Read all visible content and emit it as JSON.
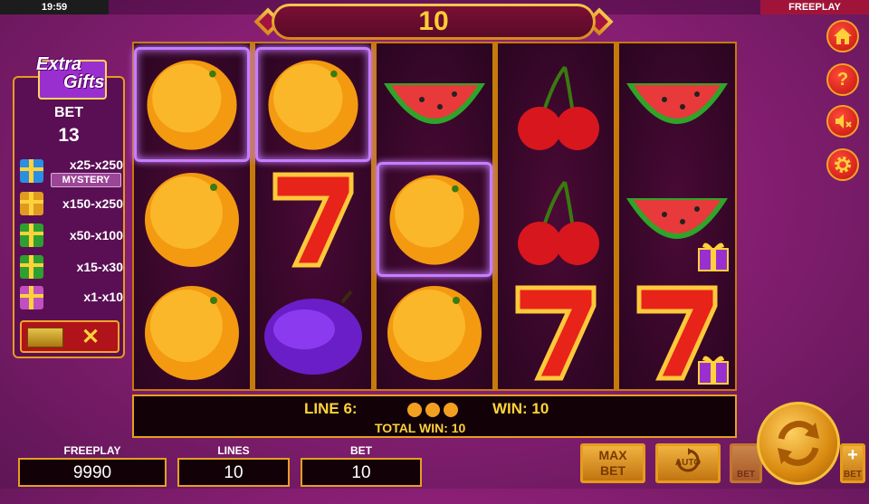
{
  "status_bar": {
    "time": "19:59",
    "mode": "FREEPLAY"
  },
  "top_counter": "10",
  "side_buttons": [
    "home-icon",
    "question-icon",
    "speaker-muted-icon",
    "gear-icon"
  ],
  "bonus_panel": {
    "logo_line1": "Extra",
    "logo_line2": "Gifts",
    "bet_label": "BET",
    "bet_value": "13",
    "tiers": [
      {
        "range": "x25-x250",
        "color": "#2a8fe0"
      },
      {
        "range": "x150-x250",
        "color": "#e09a20"
      },
      {
        "range": "x50-x100",
        "color": "#2ea030"
      },
      {
        "range": "x15-x30",
        "color": "#2ea030"
      },
      {
        "range": "x1-x10",
        "color": "#c050c0"
      }
    ],
    "mystery_label": "MYSTERY",
    "close_symbol": "✕"
  },
  "reels": [
    [
      "orange",
      "orange",
      "orange"
    ],
    [
      "orange",
      "seven",
      "plum"
    ],
    [
      "watermelon",
      "orange",
      "orange"
    ],
    [
      "cherry",
      "cherry",
      "seven"
    ],
    [
      "watermelon",
      "watermelon",
      "seven"
    ]
  ],
  "win_info": {
    "line_label": "LINE 6:",
    "win_label": "WIN: 10",
    "total_label": "TOTAL WIN: 10"
  },
  "bottom": {
    "credit_label": "FREEPLAY",
    "credit_value": "9990",
    "lines_label": "LINES",
    "lines_value": "10",
    "bet_label": "BET",
    "bet_value": "10",
    "max_bet_line1": "MAX",
    "max_bet_line2": "BET",
    "auto_label": "AUTO",
    "bet_minus_label": "BET",
    "bet_plus_label": "BET",
    "plus_symbol": "+"
  },
  "colors": {
    "accent": "#e69b1c",
    "text_yellow": "#ffd23a",
    "highlight": "#c77dff"
  }
}
